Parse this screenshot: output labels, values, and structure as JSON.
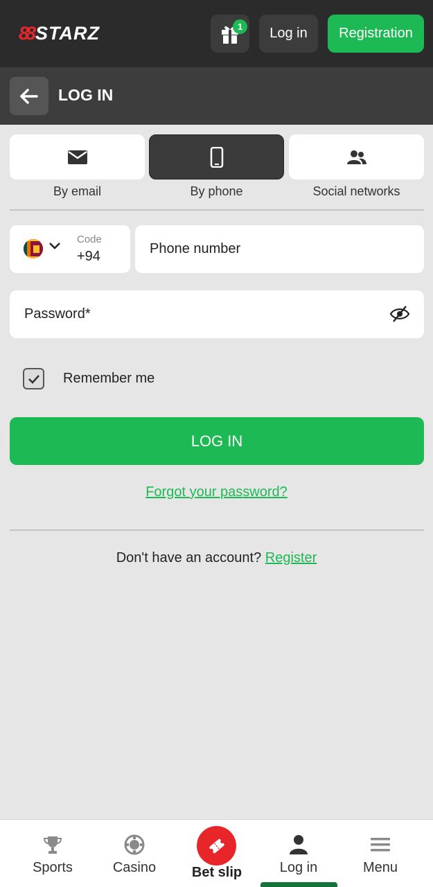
{
  "header": {
    "logo_mark": "88",
    "logo_text": "STARZ",
    "gift_badge": "1",
    "login_label": "Log in",
    "registration_label": "Registration"
  },
  "subheader": {
    "title": "LOG IN"
  },
  "tabs": [
    {
      "label": "By email",
      "icon": "envelope-icon",
      "active": false
    },
    {
      "label": "By phone",
      "icon": "phone-icon",
      "active": true
    },
    {
      "label": "Social networks",
      "icon": "users-icon",
      "active": false
    }
  ],
  "form": {
    "code_label": "Code",
    "code_value": "+94",
    "flag": "sri-lanka-flag-icon",
    "phone_placeholder": "Phone number",
    "password_placeholder": "Password*",
    "remember_label": "Remember me",
    "remember_checked": true,
    "submit_label": "LOG IN",
    "forgot_label": "Forgot your password?",
    "no_account_text": "Don't have an account?",
    "register_link": "Register"
  },
  "bottom_nav": [
    {
      "label": "Sports",
      "icon": "trophy-icon"
    },
    {
      "label": "Casino",
      "icon": "casino-chip-icon"
    },
    {
      "label": "Bet slip",
      "icon": "ticket-icon"
    },
    {
      "label": "Log in",
      "icon": "user-icon",
      "active": true
    },
    {
      "label": "Menu",
      "icon": "hamburger-icon"
    }
  ],
  "colors": {
    "accent_green": "#1db954",
    "brand_red": "#e8262a",
    "header_dark": "#2b2b2b",
    "background": "#e6e6e6"
  }
}
